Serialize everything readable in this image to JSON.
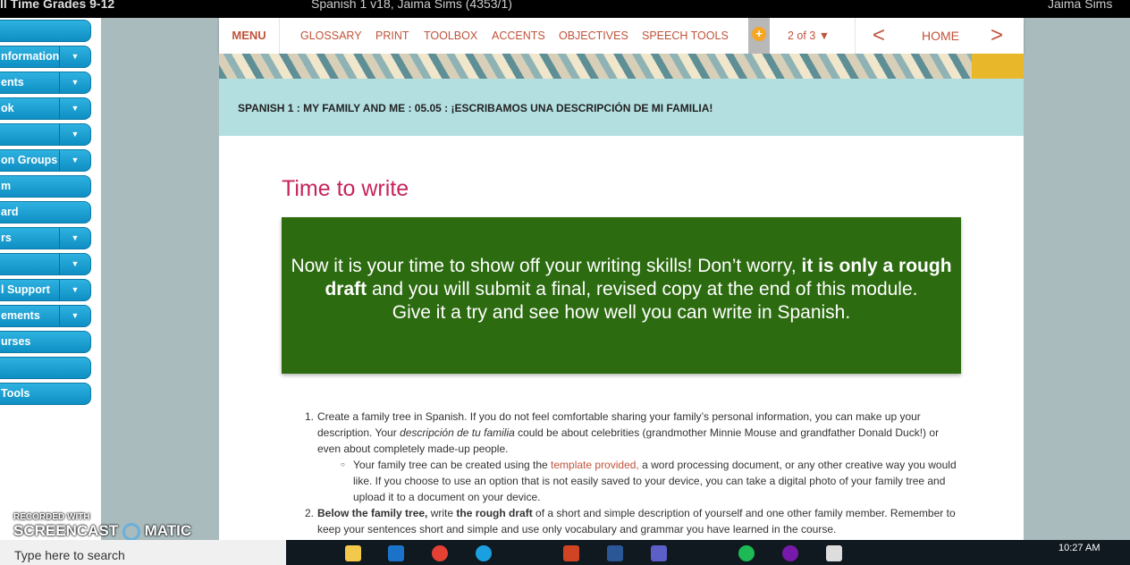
{
  "topbar": {
    "left_title": "ll Time Grades 9-12",
    "course": "Spanish 1 v18, Jaima Sims (4353/1)",
    "user": "Jaima Sims"
  },
  "sidebar": {
    "items": [
      {
        "label": "",
        "dropdown": false
      },
      {
        "label": "nformation",
        "dropdown": true
      },
      {
        "label": "ents",
        "dropdown": true
      },
      {
        "label": "ok",
        "dropdown": true
      },
      {
        "label": "",
        "dropdown": true
      },
      {
        "label": "on Groups",
        "dropdown": true
      },
      {
        "label": "m",
        "dropdown": false
      },
      {
        "label": "ard",
        "dropdown": false
      },
      {
        "label": "rs",
        "dropdown": true
      },
      {
        "label": "",
        "dropdown": true
      },
      {
        "label": "l Support",
        "dropdown": true
      },
      {
        "label": "ements",
        "dropdown": true
      },
      {
        "label": "urses",
        "dropdown": false
      },
      {
        "label": "",
        "dropdown": false
      },
      {
        "label": "Tools",
        "dropdown": false
      }
    ]
  },
  "nav": {
    "menu": "MENU",
    "glossary": "GLOSSARY",
    "print": "PRINT",
    "toolbox": "TOOLBOX",
    "accents": "ACCENTS",
    "objectives": "OBJECTIVES",
    "speech_tools": "SPEECH TOOLS",
    "page": "2 of 3 ▼",
    "prev": "<",
    "home": "HOME",
    "next": ">"
  },
  "breadcrumb": "SPANISH 1 : MY FAMILY AND ME : 05.05 : ¡ESCRIBAMOS UNA DESCRIPCIÓN DE MI FAMILIA!",
  "main": {
    "title": "Time to write",
    "callout": {
      "a": "Now it is your time to show off your writing skills! Don’t worry, ",
      "b": "it is only a rough draft",
      "c": " and you will submit a final, revised copy at the end of this module.",
      "d": "Give it a try and see how well you can write in Spanish."
    },
    "item1": {
      "num": "1.",
      "a": "Create a family tree in Spanish. If you do not feel comfortable sharing your family’s personal information, you can make up your description. Your ",
      "em": "descripción de tu familia",
      "b": " could be about celebrities (grandmother Minnie Mouse and grandfather Donald Duck!) or even about completely made-up people.",
      "sub_a": "Your family tree can be created using the ",
      "sub_link": "template provided,",
      "sub_b": " a word processing document, or any other creative way you would like. If you choose to use an option that is not easily saved to your device, you can take a digital photo of your family tree and upload it to a document on your device."
    },
    "item2": {
      "num": "2.",
      "b1": "Below the family tree,",
      "a": " write ",
      "b2": "the rough draft",
      "c": " of a short and simple description of yourself and one other family member. Remember to keep your sentences short and simple and use only vocabulary and grammar you have learned in the course."
    }
  },
  "watermark": {
    "line1": "RECORDED WITH",
    "line2": "SCREENCAST",
    "line3": "MATIC"
  },
  "taskbar": {
    "search_placeholder": "Type here to search",
    "time": "10:27 AM"
  },
  "colors": {
    "accent": "#c0533a",
    "title": "#c8245b",
    "callout": "#2c6b10",
    "header": "#b3dfe1",
    "sidebar": "#1ba0d4"
  }
}
